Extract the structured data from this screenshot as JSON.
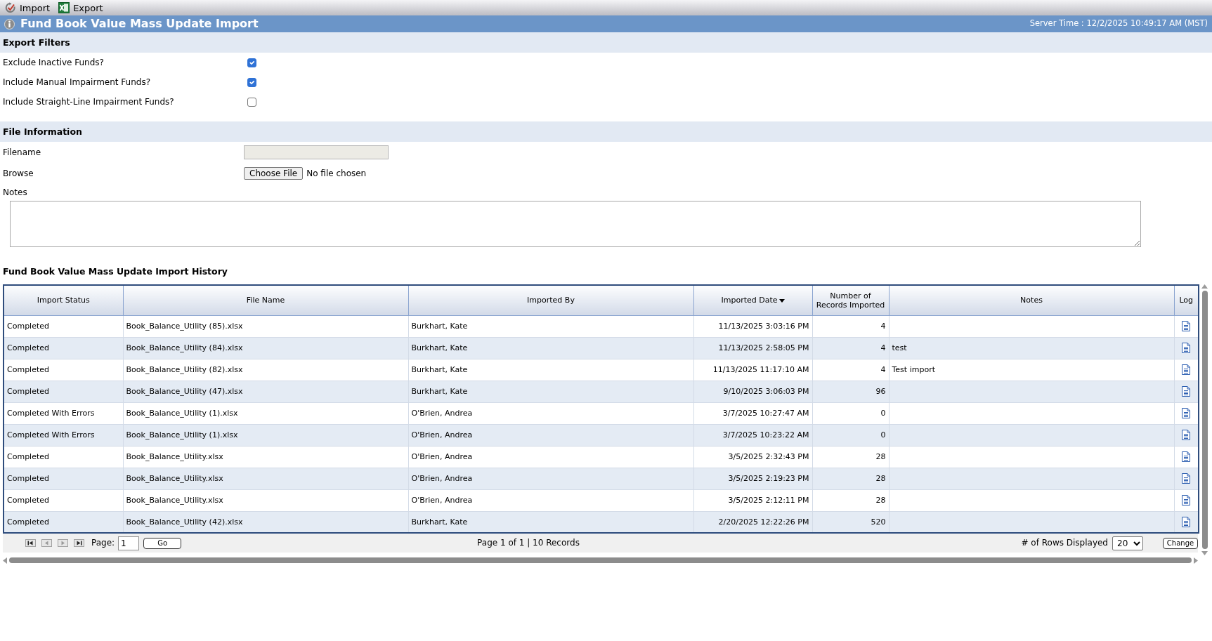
{
  "toolbar": {
    "buttons": [
      {
        "label": "Import",
        "kind": "import"
      },
      {
        "label": "Export",
        "kind": "export"
      }
    ]
  },
  "title_bar": {
    "title": "Fund Book Value Mass Update Import",
    "server_time": "Server Time : 12/2/2025 10:49:17 AM (MST)"
  },
  "export_filters": {
    "heading": "Export Filters",
    "items": [
      {
        "label": "Exclude Inactive Funds?",
        "checked": true
      },
      {
        "label": "Include Manual Impairment Funds?",
        "checked": true
      },
      {
        "label": "Include Straight-Line Impairment Funds?",
        "checked": false
      }
    ]
  },
  "file_information": {
    "heading": "File Information",
    "filename": {
      "label": "Filename",
      "disabled": true
    },
    "browse": {
      "label": "Browse",
      "button": "Choose File",
      "status": "No file chosen"
    },
    "notes": {
      "label": "Notes"
    }
  },
  "history": {
    "title": "Fund Book Value Mass Update Import History",
    "columns": [
      {
        "label": "Import Status",
        "kind": "text",
        "sorted": false
      },
      {
        "label": "File Name",
        "kind": "text",
        "sorted": false
      },
      {
        "label": "Imported By",
        "kind": "text",
        "sorted": false
      },
      {
        "label": "Imported Date",
        "kind": "date",
        "sorted": true
      },
      {
        "label": "Number of Records Imported",
        "kind": "number",
        "sorted": false
      },
      {
        "label": "Notes",
        "kind": "text",
        "sorted": false
      },
      {
        "label": "Log",
        "kind": "icon",
        "sorted": false
      }
    ],
    "rows": [
      {
        "status": "Completed",
        "file_name": "Book_Balance_Utility (85).xlsx",
        "imported_by": "Burkhart, Kate",
        "imported_date": "11/13/2025 3:03:16 PM",
        "records": "4"
      },
      {
        "status": "Completed",
        "file_name": "Book_Balance_Utility (84).xlsx",
        "imported_by": "Burkhart, Kate",
        "imported_date": "11/13/2025 2:58:05 PM",
        "records": "4",
        "notes": "test"
      },
      {
        "status": "Completed",
        "file_name": "Book_Balance_Utility (82).xlsx",
        "imported_by": "Burkhart, Kate",
        "imported_date": "11/13/2025 11:17:10 AM",
        "records": "4",
        "notes": "Test import"
      },
      {
        "status": "Completed",
        "file_name": "Book_Balance_Utility (47).xlsx",
        "imported_by": "Burkhart, Kate",
        "imported_date": "9/10/2025 3:06:03 PM",
        "records": "96"
      },
      {
        "status": "Completed With Errors",
        "file_name": "Book_Balance_Utility (1).xlsx",
        "imported_by": "O'Brien, Andrea",
        "imported_date": "3/7/2025 10:27:47 AM",
        "records": "0"
      },
      {
        "status": "Completed With Errors",
        "file_name": "Book_Balance_Utility (1).xlsx",
        "imported_by": "O'Brien, Andrea",
        "imported_date": "3/7/2025 10:23:22 AM",
        "records": "0"
      },
      {
        "status": "Completed",
        "file_name": "Book_Balance_Utility.xlsx",
        "imported_by": "O'Brien, Andrea",
        "imported_date": "3/5/2025 2:32:43 PM",
        "records": "28"
      },
      {
        "status": "Completed",
        "file_name": "Book_Balance_Utility.xlsx",
        "imported_by": "O'Brien, Andrea",
        "imported_date": "3/5/2025 2:19:23 PM",
        "records": "28"
      },
      {
        "status": "Completed",
        "file_name": "Book_Balance_Utility.xlsx",
        "imported_by": "O'Brien, Andrea",
        "imported_date": "3/5/2025 2:12:11 PM",
        "records": "28"
      },
      {
        "status": "Completed",
        "file_name": "Book_Balance_Utility (42).xlsx",
        "imported_by": "Burkhart, Kate",
        "imported_date": "2/20/2025 12:22:26 PM",
        "records": "520"
      }
    ],
    "pager": {
      "page_label": "Page:",
      "page_value": "1",
      "go_button": "Go",
      "summary": "Page 1 of 1 | 10 Records",
      "rows_label": "# of Rows Displayed",
      "rows_value": "20",
      "change_button": "Change"
    }
  }
}
